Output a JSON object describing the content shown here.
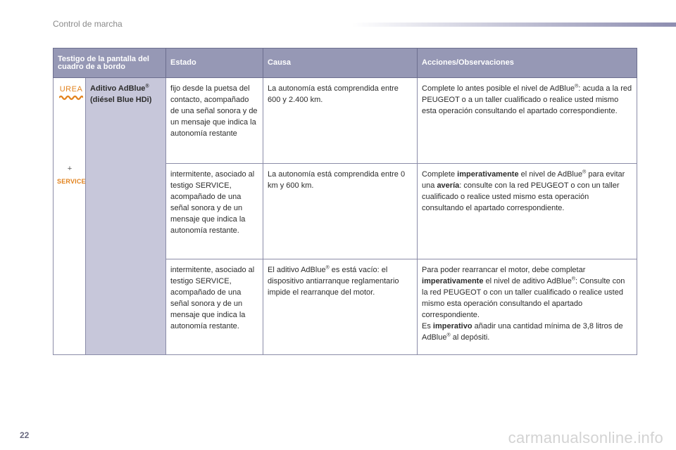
{
  "header": {
    "section_title": "Control de marcha"
  },
  "table": {
    "columns": [
      "Testigo de la pantalla del cuadro de a bordo",
      "Estado",
      "Causa",
      "Acciones/Observaciones"
    ],
    "indicator": {
      "icon_label": "UREA",
      "plus": "+",
      "service_label": "SERVICE",
      "name": "Aditivo AdBlue",
      "reg_mark": "®",
      "subname": "(diésel Blue HDi)"
    },
    "rows": [
      {
        "state": "fijo desde la puetsa del contacto, acompañado de una señal sonora y de un mensaje que indica la autonomía restante",
        "cause": "La autonomía está comprendida entre 600 y 2.400 km.",
        "action_p1": "Complete lo antes posible el nivel de AdBlue",
        "action_p2": ": acuda a la red PEUGEOT o a un taller cualificado o realice usted mismo esta operación consultando el apartado correspondiente."
      },
      {
        "state": "intermitente, asociado al testigo SERVICE, acompañado de una señal sonora y de un mensaje que indica la autonomía restante.",
        "cause": "La autonomía está comprendida entre 0 km y 600 km.",
        "action_p1": "Complete ",
        "action_bold1": "imperativamente",
        "action_p2": " el nivel de AdBlue",
        "action_p3": " para evitar una ",
        "action_bold2": "avería",
        "action_p4": ": consulte con la red PEUGEOT o con un taller cualificado o realice usted mismo esta operación consultando el apartado correspondiente."
      },
      {
        "state": "intermitente, asociado al testigo SERVICE, acompañado de una señal sonora y de un mensaje que indica la autonomía restante.",
        "cause_p1": "El aditivo AdBlue",
        "cause_p2": " es está vacío: el dispositivo antiarranque reglamentario impide el rearranque del motor.",
        "action_p1": "Para poder rearrancar el motor, debe completar ",
        "action_bold1": "imperativamente",
        "action_p2": " el nivel de aditivo AdBlue",
        "action_p3": ": Consulte con la red PEUGEOT o con un taller cualificado o realice usted mismo esta operación consultando el apartado correspondiente.",
        "action_p4": "Es ",
        "action_bold2": "imperativo",
        "action_p5": " añadir una cantidad mínima de 3,8 litros de AdBlue",
        "action_p6": " al depósiti."
      }
    ]
  },
  "footer": {
    "page_number": "22",
    "watermark": "carmanualsonline.info"
  },
  "colors": {
    "header_bg": "#9698b5",
    "label_bg": "#c7c7da",
    "icon_orange": "#e2831f"
  }
}
